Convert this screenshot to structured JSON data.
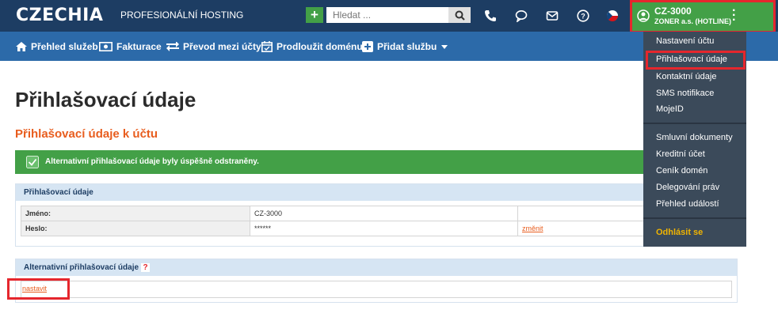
{
  "header": {
    "logo": "CZECHIA",
    "tagline": "PROFESIONÁLNÍ HOSTING",
    "search_placeholder": "Hledat ...",
    "icons": [
      "plus-icon",
      "search-icon",
      "phone-icon",
      "chat-icon",
      "mail-icon",
      "help-icon",
      "flag-cz-icon"
    ],
    "user": {
      "name": "CZ-3000",
      "sub": "ZONER a.s. (HOTLINE)"
    }
  },
  "nav": {
    "items": [
      {
        "label": "Přehled služeb",
        "icon": "home-icon"
      },
      {
        "label": "Fakturace",
        "icon": "money-icon"
      },
      {
        "label": "Převod mezi účty",
        "icon": "transfer-icon"
      },
      {
        "label": "Prodloužit doménu",
        "icon": "calendar-icon"
      },
      {
        "label": "Přidat službu",
        "icon": "plus-square-icon"
      }
    ]
  },
  "main": {
    "title": "Přihlašovací údaje",
    "section_title": "Přihlašovací údaje k účtu",
    "alert": "Alternativní přihlašovací údaje byly úspěšně odstraněny.",
    "login_panel": {
      "heading": "Přihlašovací údaje",
      "rows": [
        {
          "key": "Jméno:",
          "value": "CZ-3000",
          "action": ""
        },
        {
          "key": "Heslo:",
          "value": "******",
          "action": "změnit"
        }
      ]
    },
    "alt_panel": {
      "heading": "Alternativní přihlašovací údaje",
      "help": "?",
      "set_link": "nastavit"
    }
  },
  "dropdown": {
    "group1": [
      "Nastavení účtu",
      "Přihlašovací údaje",
      "Kontaktní údaje",
      "SMS notifikace",
      "MojeID"
    ],
    "group2": [
      "Smluvní dokumenty",
      "Kreditní účet",
      "Ceník domén",
      "Delegování práv",
      "Přehled událostí"
    ],
    "logout": "Odhlásit se"
  }
}
